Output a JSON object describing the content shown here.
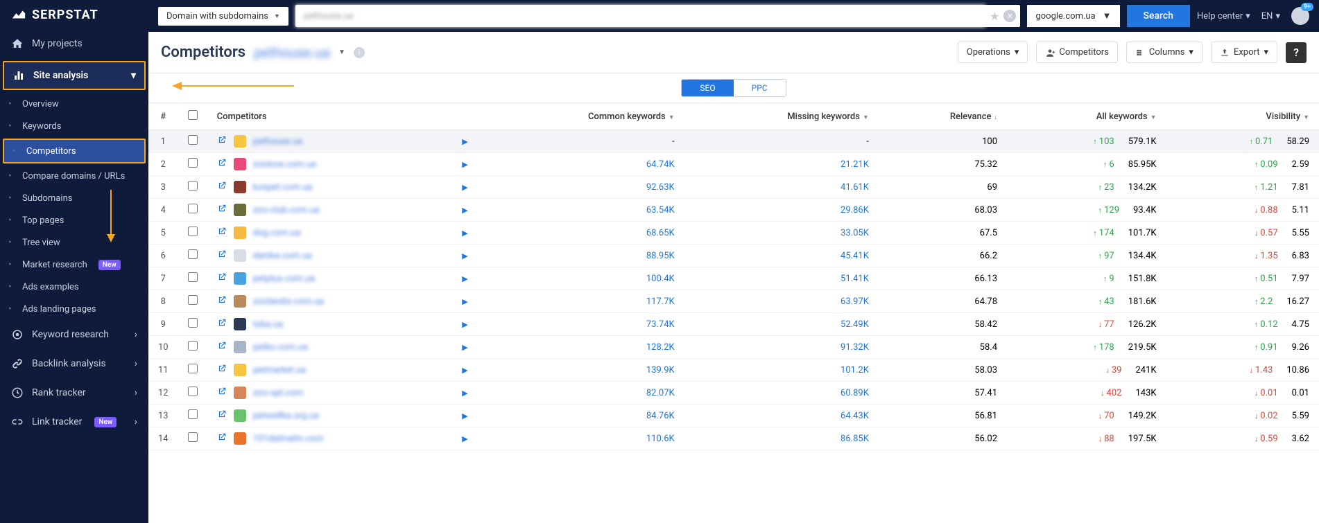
{
  "brand": "SERPSTAT",
  "topbar": {
    "domain_mode": "Domain with subdomains",
    "search_value": "pethouse.ua",
    "engine": "google.com.ua",
    "search_btn": "Search",
    "help": "Help center",
    "lang": "EN",
    "notif": "9+"
  },
  "sidebar": {
    "my_projects": "My projects",
    "site_analysis": "Site analysis",
    "subs": [
      {
        "label": "Overview"
      },
      {
        "label": "Keywords"
      },
      {
        "label": "Competitors",
        "active": true
      },
      {
        "label": "Compare domains / URLs"
      },
      {
        "label": "Subdomains"
      },
      {
        "label": "Top pages"
      },
      {
        "label": "Tree view"
      },
      {
        "label": "Market research",
        "new": true
      },
      {
        "label": "Ads examples"
      },
      {
        "label": "Ads landing pages"
      }
    ],
    "groups": [
      {
        "label": "Keyword research"
      },
      {
        "label": "Backlink analysis"
      },
      {
        "label": "Rank tracker"
      },
      {
        "label": "Link tracker",
        "new": true
      }
    ]
  },
  "page": {
    "title": "Competitors",
    "domain": "pethouse.ua",
    "operations": "Operations",
    "competitors_btn": "Competitors",
    "columns_btn": "Columns",
    "export_btn": "Export",
    "tab_seo": "SEO",
    "tab_ppc": "PPC"
  },
  "table": {
    "headers": {
      "idx": "#",
      "competitors": "Competitors",
      "common": "Common keywords",
      "missing": "Missing keywords",
      "relevance": "Relevance",
      "allkw": "All keywords",
      "visibility": "Visibility"
    },
    "rows": [
      {
        "n": 1,
        "domain": "pethouse.ua",
        "fav": "#f5c542",
        "common": "-",
        "missing": "-",
        "rel": "100",
        "allkw_d": "103",
        "allkw_dir": "up",
        "allkw": "579.1K",
        "vis_d": "0.71",
        "vis_dir": "up",
        "vis": "58.29",
        "first": true
      },
      {
        "n": 2,
        "domain": "zoolove.com.ua",
        "fav": "#e84a7a",
        "common": "64.74K",
        "missing": "21.21K",
        "rel": "75.32",
        "allkw_d": "6",
        "allkw_dir": "up",
        "allkw": "85.95K",
        "vis_d": "0.09",
        "vis_dir": "up",
        "vis": "2.59"
      },
      {
        "n": 3,
        "domain": "kospet.com.ua",
        "fav": "#8b3a2e",
        "common": "92.63K",
        "missing": "41.61K",
        "rel": "69",
        "allkw_d": "23",
        "allkw_dir": "up",
        "allkw": "134.2K",
        "vis_d": "1.21",
        "vis_dir": "up",
        "vis": "7.81"
      },
      {
        "n": 4,
        "domain": "zoo-club.com.ua",
        "fav": "#6b6b3a",
        "common": "63.54K",
        "missing": "29.86K",
        "rel": "68.03",
        "allkw_d": "129",
        "allkw_dir": "up",
        "allkw": "93.4K",
        "vis_d": "0.88",
        "vis_dir": "down",
        "vis": "5.11"
      },
      {
        "n": 5,
        "domain": "dog.com.ua",
        "fav": "#f5b942",
        "common": "68.65K",
        "missing": "33.05K",
        "rel": "67.5",
        "allkw_d": "174",
        "allkw_dir": "up",
        "allkw": "101.7K",
        "vis_d": "0.57",
        "vis_dir": "down",
        "vis": "5.55"
      },
      {
        "n": 6,
        "domain": "danika.com.ua",
        "fav": "#d8dde6",
        "common": "88.95K",
        "missing": "45.41K",
        "rel": "66.2",
        "allkw_d": "97",
        "allkw_dir": "up",
        "allkw": "134.4K",
        "vis_d": "1.35",
        "vis_dir": "down",
        "vis": "6.83"
      },
      {
        "n": 7,
        "domain": "petplus.com.ua",
        "fav": "#4aa3e0",
        "common": "100.4K",
        "missing": "51.41K",
        "rel": "66.13",
        "allkw_d": "9",
        "allkw_dir": "up",
        "allkw": "151.8K",
        "vis_d": "0.51",
        "vis_dir": "up",
        "vis": "7.97"
      },
      {
        "n": 8,
        "domain": "zoolandix.com.ua",
        "fav": "#b88a5a",
        "common": "117.7K",
        "missing": "63.97K",
        "rel": "64.78",
        "allkw_d": "43",
        "allkw_dir": "up",
        "allkw": "181.6K",
        "vis_d": "2.2",
        "vis_dir": "up",
        "vis": "16.27"
      },
      {
        "n": 9,
        "domain": "toba.ua",
        "fav": "#2b3a55",
        "common": "73.74K",
        "missing": "52.49K",
        "rel": "58.42",
        "allkw_d": "77",
        "allkw_dir": "down",
        "allkw": "126.2K",
        "vis_d": "0.12",
        "vis_dir": "up",
        "vis": "4.75"
      },
      {
        "n": 10,
        "domain": "petko.com.ua",
        "fav": "#a8b5c7",
        "common": "128.2K",
        "missing": "91.32K",
        "rel": "58.4",
        "allkw_d": "178",
        "allkw_dir": "up",
        "allkw": "219.5K",
        "vis_d": "0.91",
        "vis_dir": "up",
        "vis": "9.26"
      },
      {
        "n": 11,
        "domain": "petmarket.ua",
        "fav": "#f5c542",
        "common": "139.9K",
        "missing": "101.2K",
        "rel": "58.03",
        "allkw_d": "39",
        "allkw_dir": "down",
        "allkw": "241K",
        "vis_d": "1.43",
        "vis_dir": "down",
        "vis": "10.86"
      },
      {
        "n": 12,
        "domain": "zoo-opt.com",
        "fav": "#d8855a",
        "common": "82.07K",
        "missing": "60.89K",
        "rel": "57.41",
        "allkw_d": "402",
        "allkw_dir": "down",
        "allkw": "143K",
        "vis_d": "0.01",
        "vis_dir": "down",
        "vis": "0.01"
      },
      {
        "n": 13,
        "domain": "petwellka.org.ua",
        "fav": "#6bc46b",
        "common": "84.76K",
        "missing": "64.43K",
        "rel": "56.81",
        "allkw_d": "70",
        "allkw_dir": "down",
        "allkw": "149.2K",
        "vis_d": "0.02",
        "vis_dir": "down",
        "vis": "5.59"
      },
      {
        "n": 14,
        "domain": "101dalmatin.com",
        "fav": "#e8742e",
        "common": "110.6K",
        "missing": "86.85K",
        "rel": "56.02",
        "allkw_d": "88",
        "allkw_dir": "down",
        "allkw": "197.5K",
        "vis_d": "0.59",
        "vis_dir": "down",
        "vis": "3.62"
      }
    ]
  }
}
